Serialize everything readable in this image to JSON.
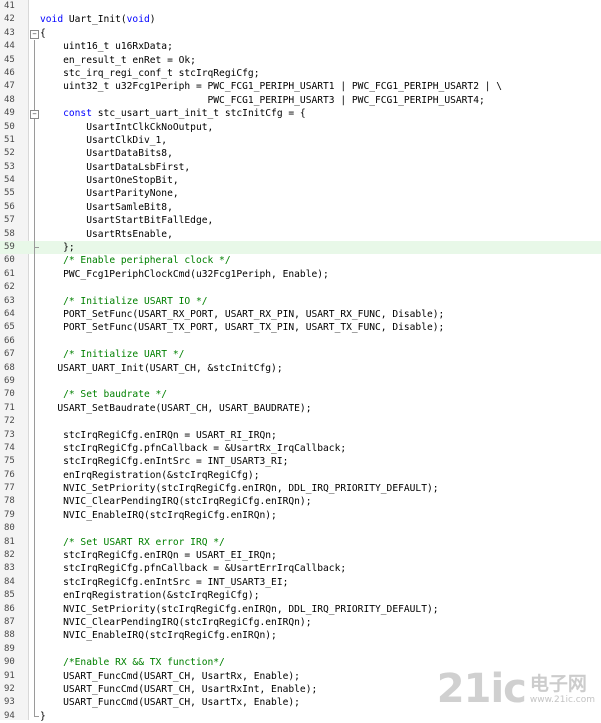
{
  "editor": {
    "highlight_line": "59",
    "lines": [
      {
        "num": "41",
        "parts": []
      },
      {
        "num": "42",
        "parts": [
          {
            "t": "void",
            "c": "kw"
          },
          {
            "t": " Uart_Init("
          },
          {
            "t": "void",
            "c": "kw"
          },
          {
            "t": ")"
          }
        ]
      },
      {
        "num": "43",
        "parts": [
          {
            "t": "{"
          }
        ],
        "fold": "start"
      },
      {
        "num": "44",
        "parts": [
          {
            "t": "    uint16_t u16RxData;"
          }
        ]
      },
      {
        "num": "45",
        "parts": [
          {
            "t": "    en_result_t enRet = Ok;"
          }
        ]
      },
      {
        "num": "46",
        "parts": [
          {
            "t": "    stc_irq_regi_conf_t stcIrqRegiCfg;"
          }
        ]
      },
      {
        "num": "47",
        "parts": [
          {
            "t": "    uint32_t u32Fcg1Periph = PWC_FCG1_PERIPH_USART1 | PWC_FCG1_PERIPH_USART2 | \\"
          }
        ]
      },
      {
        "num": "48",
        "parts": [
          {
            "t": "                             PWC_FCG1_PERIPH_USART3 | PWC_FCG1_PERIPH_USART4;"
          }
        ]
      },
      {
        "num": "49",
        "parts": [
          {
            "t": "    "
          },
          {
            "t": "const",
            "c": "kw"
          },
          {
            "t": " stc_usart_uart_init_t stcInitCfg = {"
          }
        ],
        "fold": "start"
      },
      {
        "num": "50",
        "parts": [
          {
            "t": "        UsartIntClkCkNoOutput,"
          }
        ]
      },
      {
        "num": "51",
        "parts": [
          {
            "t": "        UsartClkDiv_1,"
          }
        ]
      },
      {
        "num": "52",
        "parts": [
          {
            "t": "        UsartDataBits8,"
          }
        ]
      },
      {
        "num": "53",
        "parts": [
          {
            "t": "        UsartDataLsbFirst,"
          }
        ]
      },
      {
        "num": "54",
        "parts": [
          {
            "t": "        UsartOneStopBit,"
          }
        ]
      },
      {
        "num": "55",
        "parts": [
          {
            "t": "        UsartParityNone,"
          }
        ]
      },
      {
        "num": "56",
        "parts": [
          {
            "t": "        UsartSamleBit8,"
          }
        ]
      },
      {
        "num": "57",
        "parts": [
          {
            "t": "        UsartStartBitFallEdge,"
          }
        ]
      },
      {
        "num": "58",
        "parts": [
          {
            "t": "        UsartRtsEnable,"
          }
        ]
      },
      {
        "num": "59",
        "parts": [
          {
            "t": "    };"
          }
        ],
        "fold": "inner-end"
      },
      {
        "num": "60",
        "parts": [
          {
            "t": "    "
          },
          {
            "t": "/* Enable peripheral clock */",
            "c": "cm"
          }
        ]
      },
      {
        "num": "61",
        "parts": [
          {
            "t": "    PWC_Fcg1PeriphClockCmd(u32Fcg1Periph, Enable);"
          }
        ]
      },
      {
        "num": "62",
        "parts": []
      },
      {
        "num": "63",
        "parts": [
          {
            "t": "    "
          },
          {
            "t": "/* Initialize USART IO */",
            "c": "cm"
          }
        ]
      },
      {
        "num": "64",
        "parts": [
          {
            "t": "    PORT_SetFunc(USART_RX_PORT, USART_RX_PIN, USART_RX_FUNC, Disable);"
          }
        ]
      },
      {
        "num": "65",
        "parts": [
          {
            "t": "    PORT_SetFunc(USART_TX_PORT, USART_TX_PIN, USART_TX_FUNC, Disable);"
          }
        ]
      },
      {
        "num": "66",
        "parts": []
      },
      {
        "num": "67",
        "parts": [
          {
            "t": "    "
          },
          {
            "t": "/* Initialize UART */",
            "c": "cm"
          }
        ]
      },
      {
        "num": "68",
        "parts": [
          {
            "t": "   USART_UART_Init(USART_CH, &stcInitCfg);"
          }
        ]
      },
      {
        "num": "69",
        "parts": []
      },
      {
        "num": "70",
        "parts": [
          {
            "t": "    "
          },
          {
            "t": "/* Set baudrate */",
            "c": "cm"
          }
        ]
      },
      {
        "num": "71",
        "parts": [
          {
            "t": "   USART_SetBaudrate(USART_CH, USART_BAUDRATE);"
          }
        ]
      },
      {
        "num": "72",
        "parts": []
      },
      {
        "num": "73",
        "parts": [
          {
            "t": "    stcIrqRegiCfg.enIRQn = USART_RI_IRQn;"
          }
        ]
      },
      {
        "num": "74",
        "parts": [
          {
            "t": "    stcIrqRegiCfg.pfnCallback = &UsartRx_IrqCallback;"
          }
        ]
      },
      {
        "num": "75",
        "parts": [
          {
            "t": "    stcIrqRegiCfg.enIntSrc = INT_USART3_RI;"
          }
        ]
      },
      {
        "num": "76",
        "parts": [
          {
            "t": "    enIrqRegistration(&stcIrqRegiCfg);"
          }
        ]
      },
      {
        "num": "77",
        "parts": [
          {
            "t": "    NVIC_SetPriority(stcIrqRegiCfg.enIRQn, DDL_IRQ_PRIORITY_DEFAULT);"
          }
        ]
      },
      {
        "num": "78",
        "parts": [
          {
            "t": "    NVIC_ClearPendingIRQ(stcIrqRegiCfg.enIRQn);"
          }
        ]
      },
      {
        "num": "79",
        "parts": [
          {
            "t": "    NVIC_EnableIRQ(stcIrqRegiCfg.enIRQn);"
          }
        ]
      },
      {
        "num": "80",
        "parts": []
      },
      {
        "num": "81",
        "parts": [
          {
            "t": "    "
          },
          {
            "t": "/* Set USART RX error IRQ */",
            "c": "cm"
          }
        ]
      },
      {
        "num": "82",
        "parts": [
          {
            "t": "    stcIrqRegiCfg.enIRQn = USART_EI_IRQn;"
          }
        ]
      },
      {
        "num": "83",
        "parts": [
          {
            "t": "    stcIrqRegiCfg.pfnCallback = &UsartErrIrqCallback;"
          }
        ]
      },
      {
        "num": "84",
        "parts": [
          {
            "t": "    stcIrqRegiCfg.enIntSrc = INT_USART3_EI;"
          }
        ]
      },
      {
        "num": "85",
        "parts": [
          {
            "t": "    enIrqRegistration(&stcIrqRegiCfg);"
          }
        ]
      },
      {
        "num": "86",
        "parts": [
          {
            "t": "    NVIC_SetPriority(stcIrqRegiCfg.enIRQn, DDL_IRQ_PRIORITY_DEFAULT);"
          }
        ]
      },
      {
        "num": "87",
        "parts": [
          {
            "t": "    NVIC_ClearPendingIRQ(stcIrqRegiCfg.enIRQn);"
          }
        ]
      },
      {
        "num": "88",
        "parts": [
          {
            "t": "    NVIC_EnableIRQ(stcIrqRegiCfg.enIRQn);"
          }
        ]
      },
      {
        "num": "89",
        "parts": []
      },
      {
        "num": "90",
        "parts": [
          {
            "t": "    "
          },
          {
            "t": "/*Enable RX && TX function*/",
            "c": "cm"
          }
        ]
      },
      {
        "num": "91",
        "parts": [
          {
            "t": "    USART_FuncCmd(USART_CH, UsartRx, Enable);"
          }
        ]
      },
      {
        "num": "92",
        "parts": [
          {
            "t": "    USART_FuncCmd(USART_CH, UsartRxInt, Enable);"
          }
        ]
      },
      {
        "num": "93",
        "parts": [
          {
            "t": "    USART_FuncCmd(USART_CH, UsartTx, Enable);"
          }
        ]
      },
      {
        "num": "94",
        "parts": [
          {
            "t": "}"
          }
        ],
        "fold": "end"
      }
    ]
  },
  "watermark": {
    "logo": "21ic",
    "name": "电子网",
    "url": "www.21ic.com"
  }
}
